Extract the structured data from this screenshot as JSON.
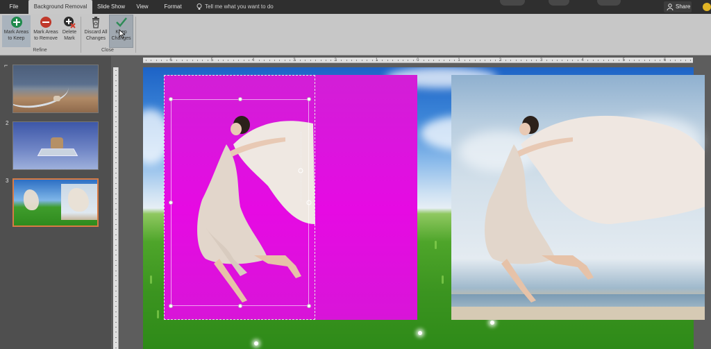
{
  "tabs": [
    {
      "label": "File",
      "active": false
    },
    {
      "label": "Background Removal",
      "active": true
    },
    {
      "label": "Slide Show",
      "active": false
    },
    {
      "label": "View",
      "active": false
    },
    {
      "label": "Format",
      "active": false
    }
  ],
  "tell_me": {
    "placeholder": "Tell me what you want to do",
    "icon": "lightbulb-icon"
  },
  "share": {
    "label": "Share",
    "icon": "person-icon"
  },
  "ribbon": {
    "refine": {
      "group_label": "Refine",
      "buttons": [
        {
          "line1": "Mark Areas",
          "line2": "to Keep",
          "icon": "plus-icon",
          "color": "#1f8a4c",
          "state": "hover"
        },
        {
          "line1": "Mark Areas",
          "line2": "to Remove",
          "icon": "minus-icon",
          "color": "#c0392b",
          "state": "normal"
        },
        {
          "line1": "Delete",
          "line2": "Mark",
          "icon": "delete-mark-icon",
          "color": "#333333",
          "state": "normal"
        }
      ]
    },
    "close": {
      "group_label": "Close",
      "buttons": [
        {
          "line1": "Discard All",
          "line2": "Changes",
          "icon": "trash-icon",
          "color": "#444444",
          "state": "normal"
        },
        {
          "line1": "Keep",
          "line2": "Changes",
          "icon": "checkmark-icon",
          "color": "#2e8b57",
          "state": "pressed"
        }
      ]
    }
  },
  "slides": [
    {
      "number": "",
      "description": "beach-dog"
    },
    {
      "number": "2",
      "description": "dog-on-plate"
    },
    {
      "number": "3",
      "description": "dancer-background-removal",
      "selected": true
    }
  ],
  "ruler": {
    "labels": [
      "6",
      "5",
      "4",
      "3",
      "2",
      "1",
      "0",
      "1",
      "2",
      "3",
      "4",
      "5",
      "6"
    ]
  },
  "colors": {
    "removal_overlay": "#dc14de",
    "selected_slide_border": "#d97b44",
    "ribbon_bg": "#c7c7c7",
    "tabbar_bg": "#2f2f2f"
  }
}
